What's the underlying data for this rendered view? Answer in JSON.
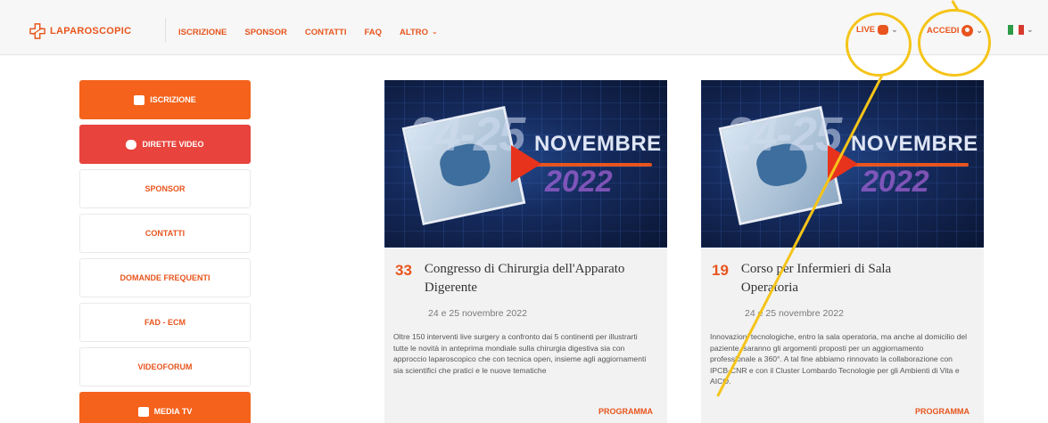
{
  "header": {
    "logo": "LAPAROSCOPIC",
    "nav": [
      "ISCRIZIONE",
      "SPONSOR",
      "CONTATTI",
      "FAQ",
      "ALTRO"
    ],
    "live": "LIVE",
    "accedi": "ACCEDI",
    "lang_colors": [
      "#2e9b47",
      "#ffffff",
      "#d63a2f"
    ]
  },
  "sidebar": {
    "items": [
      {
        "label": "ISCRIZIONE",
        "style": "orange",
        "icon": "briefcase-icon"
      },
      {
        "label": "DIRETTE VIDEO",
        "style": "red",
        "icon": "live-icon"
      },
      {
        "label": "SPONSOR",
        "style": "white"
      },
      {
        "label": "CONTATTI",
        "style": "white"
      },
      {
        "label": "DOMANDE FREQUENTI",
        "style": "white"
      },
      {
        "label": "FAD - ECM",
        "style": "white"
      },
      {
        "label": "VIDEOFORUM",
        "style": "white"
      },
      {
        "label": "MEDIA TV",
        "style": "orange",
        "icon": "tv-icon"
      }
    ]
  },
  "cards": [
    {
      "thumb_days": "24-25",
      "thumb_month": "NOVEMBRE",
      "thumb_year": "2022",
      "number": "33",
      "title": "Congresso di Chirurgia dell'Apparato Digerente",
      "date": "24 e 25 novembre 2022",
      "description": "Oltre 150 interventi live surgery a confronto dai 5 continenti per illustrarti tutte le novità in anteprima mondiale sulla chirurgia digestiva sia con approccio laparoscopico che con tecnica open, insieme agli aggiornamenti sia scientifici che pratici e le nuove tematiche",
      "link": "PROGRAMMA"
    },
    {
      "thumb_days": "24-25",
      "thumb_month": "NOVEMBRE",
      "thumb_year": "2022",
      "number": "19",
      "title": "Corso per Infermieri di Sala Operatoria",
      "date": "24 e 25 novembre 2022",
      "description": "Innovazioni tecnologiche, entro la sala operatoria, ma anche al domicilio del paziente, saranno gli argomenti proposti per un aggiornamento professionale a 360°. A tal fine abbiamo rinnovato la collaborazione con IPCB-CNR e con il Cluster Lombardo Tecnologie per gli Ambienti di Vita e AICO.",
      "link": "PROGRAMMA"
    }
  ],
  "colors": {
    "accent": "#e8551e",
    "annotation": "#f5c418",
    "live_red": "#e8433c"
  }
}
